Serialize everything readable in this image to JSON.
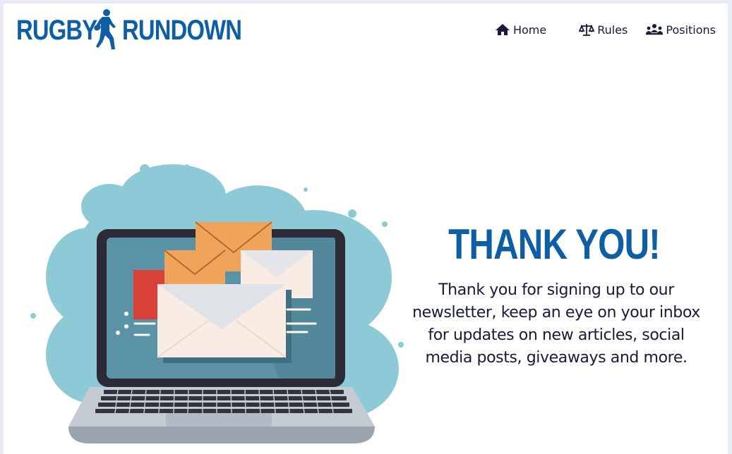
{
  "header": {
    "brand_word_1": "RUGBY",
    "brand_word_2": "RUNDOWN",
    "brand_color": "#0d5ea5"
  },
  "nav": {
    "items": [
      {
        "label": "Home",
        "icon": "home-icon"
      },
      {
        "label": "Rules",
        "icon": "scales-icon"
      },
      {
        "label": "Positions",
        "icon": "people-group-icon"
      }
    ]
  },
  "main": {
    "title": "THANK YOU!",
    "message": "Thank you for signing up to our newsletter, keep an eye on your inbox for updates on new articles, social media posts, giveaways and more.",
    "illustration": "laptop-envelopes-illustration"
  },
  "colors": {
    "text": "#151b3a",
    "accent_blue": "#0d5ea5",
    "cloud": "#8ecad6",
    "screen": "#5a93a6",
    "envelope_orange": "#f0a45b",
    "envelope_red": "#d94138"
  }
}
